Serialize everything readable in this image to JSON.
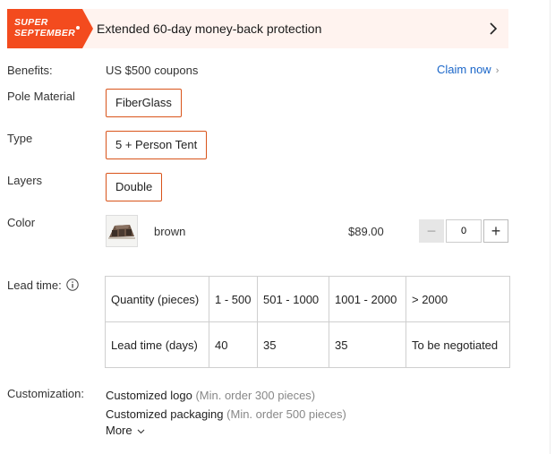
{
  "promo": {
    "badge_line1": "SUPER",
    "badge_line2": "SEPTEMBER",
    "text": "Extended 60-day money-back protection",
    "accent_color": "#f34b1e",
    "background_color": "#fff3ef"
  },
  "benefits": {
    "label": "Benefits:",
    "value": "US $500 coupons",
    "claim_label": "Claim now",
    "link_color": "#1a66c9"
  },
  "pole_material": {
    "label": "Pole Material",
    "option": "FiberGlass"
  },
  "type": {
    "label": "Type",
    "option": "5 + Person Tent"
  },
  "layers": {
    "label": "Layers",
    "option": "Double"
  },
  "color": {
    "label": "Color",
    "name": "brown",
    "price": "$89.00",
    "quantity": "0",
    "minus_symbol": "−",
    "plus_symbol": "+"
  },
  "lead_time": {
    "label": "Lead time:",
    "rows": [
      [
        "Quantity (pieces)",
        "1 - 500",
        "501 - 1000",
        "1001 - 2000",
        "> 2000"
      ],
      [
        "Lead time (days)",
        "40",
        "35",
        "35",
        "To be negotiated"
      ]
    ]
  },
  "customization": {
    "label": "Customization:",
    "items": [
      {
        "name": "Customized logo",
        "note": "(Min. order 300 pieces)"
      },
      {
        "name": "Customized packaging",
        "note": "(Min. order 500 pieces)"
      }
    ],
    "more_label": "More"
  },
  "selected_border_color": "#d9541a"
}
